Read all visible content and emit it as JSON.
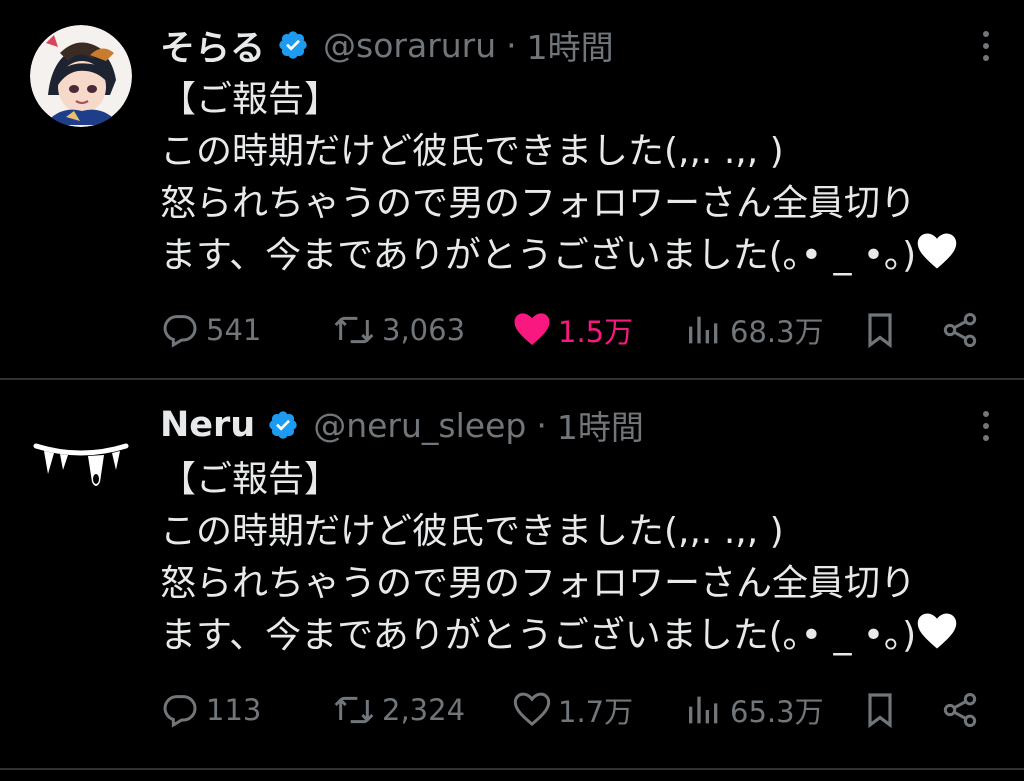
{
  "colors": {
    "background": "#000000",
    "text": "#e7e9ea",
    "muted": "#71767b",
    "like_active": "#f91880",
    "verified": "#1d9bf0",
    "divider": "#2f3336"
  },
  "tweets": [
    {
      "display_name": "そらる",
      "verified_icon": "verified-badge-icon",
      "handle": "@soraruru",
      "separator": "·",
      "time": "1時間",
      "text_lines": [
        "【ご報告】",
        "この時期だけど彼氏できました(,,. .,, )",
        "怒られちゃうので男のフォロワーさん全員切り",
        "ます、今までありがとうございました(｡• _ •｡)"
      ],
      "reply_count": "541",
      "repost_count": "3,063",
      "like_count": "1.5万",
      "like_active": true,
      "view_count": "68.3万"
    },
    {
      "display_name": "Neru",
      "verified_icon": "verified-badge-icon",
      "handle": "@neru_sleep",
      "separator": "·",
      "time": "1時間",
      "text_lines": [
        "【ご報告】",
        "この時期だけど彼氏できました(,,. .,, )",
        "怒られちゃうので男のフォロワーさん全員切り",
        "ます、今までありがとうございました(｡• _ •｡)"
      ],
      "reply_count": "113",
      "repost_count": "2,324",
      "like_count": "1.7万",
      "like_active": false,
      "view_count": "65.3万"
    }
  ]
}
